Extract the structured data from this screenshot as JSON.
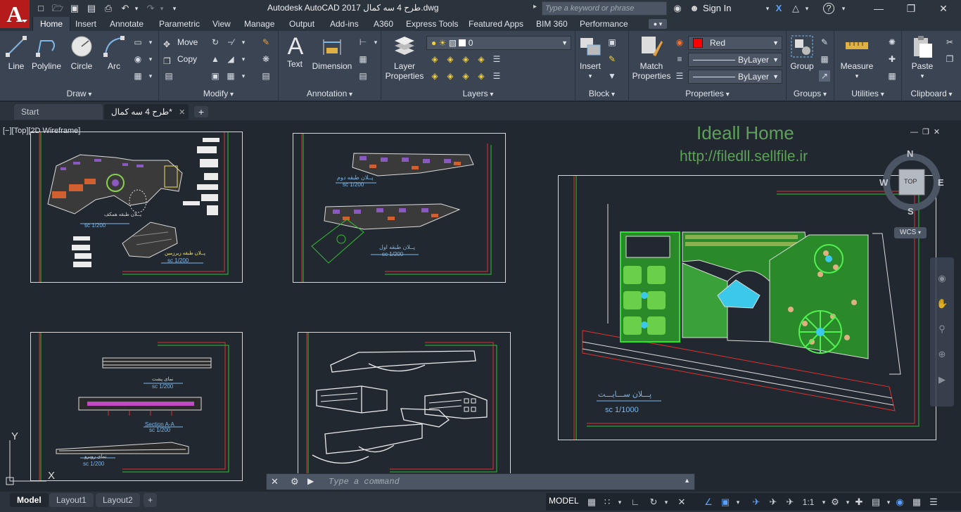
{
  "app": {
    "title": "Autodesk AutoCAD 2017   طرح 4 سه کمال.dwg",
    "logo_letter": "A",
    "search_placeholder": "Type a keyword or phrase",
    "sign_in": "Sign In"
  },
  "tabs": [
    {
      "label": "Home",
      "active": true
    },
    {
      "label": "Insert"
    },
    {
      "label": "Annotate"
    },
    {
      "label": "Parametric"
    },
    {
      "label": "View"
    },
    {
      "label": "Manage"
    },
    {
      "label": "Output"
    },
    {
      "label": "Add-ins"
    },
    {
      "label": "A360"
    },
    {
      "label": "Express Tools"
    },
    {
      "label": "Featured Apps"
    },
    {
      "label": "BIM 360"
    },
    {
      "label": "Performance"
    }
  ],
  "ribbon": {
    "draw": {
      "title": "Draw",
      "line": "Line",
      "polyline": "Polyline",
      "circle": "Circle",
      "arc": "Arc"
    },
    "modify": {
      "title": "Modify",
      "move": "Move",
      "copy": "Copy"
    },
    "annotation": {
      "title": "Annotation",
      "text": "Text",
      "dimension": "Dimension"
    },
    "layers": {
      "title": "Layers",
      "layer_properties_1": "Layer",
      "layer_properties_2": "Properties",
      "current_layer": "0"
    },
    "block": {
      "title": "Block",
      "insert": "Insert"
    },
    "properties": {
      "title": "Properties",
      "match_1": "Match",
      "match_2": "Properties",
      "color": "Red",
      "color_hex": "#ff0000",
      "linetype": "ByLayer",
      "lineweight": "ByLayer"
    },
    "groups": {
      "title": "Groups",
      "group": "Group"
    },
    "utilities": {
      "title": "Utilities",
      "measure": "Measure"
    },
    "clipboard": {
      "title": "Clipboard",
      "paste": "Paste"
    }
  },
  "doc_tabs": [
    {
      "label": "Start"
    },
    {
      "label": "طرح 4 سه کمال*",
      "active": true
    }
  ],
  "canvas": {
    "viewport_label": "[−][Top][2D Wireframe]",
    "watermark_title": "Ideall Home",
    "watermark_url": "http://filedll.sellfile.ir",
    "compass": {
      "n": "N",
      "s": "S",
      "e": "E",
      "w": "W",
      "top": "TOP"
    },
    "wcs": "WCS",
    "ucs_x": "X",
    "ucs_y": "Y",
    "site_plan_label": "پـــلان ســـایـــت",
    "site_plan_scale": "sc 1/1000",
    "sheet_labels": {
      "s1_a": "پــلان طبقه همکف",
      "s1_a_scale": "sc 1/200",
      "s1_b": "پــلان طبقه زیرزمین",
      "s1_b_scale": "sc 1/200",
      "s2_a": "پــلان طبقه دوم",
      "s2_a_scale": "sc 1/200",
      "s2_b": "پــلان طبقه اول",
      "s2_b_scale": "sc 1/200",
      "s3_a": "نمای پشت",
      "s3_a_scale": "sc 1/200",
      "s3_b": "Section A-A",
      "s3_b_scale": "sc 1/200",
      "s3_c": "نمای روبرو",
      "s3_c_scale": "sc 1/200"
    }
  },
  "command_line": {
    "placeholder": "Type a command"
  },
  "status": {
    "layout_tabs": [
      {
        "label": "Model",
        "active": true
      },
      {
        "label": "Layout1"
      },
      {
        "label": "Layout2"
      }
    ],
    "model": "MODEL",
    "scale": "1:1"
  }
}
